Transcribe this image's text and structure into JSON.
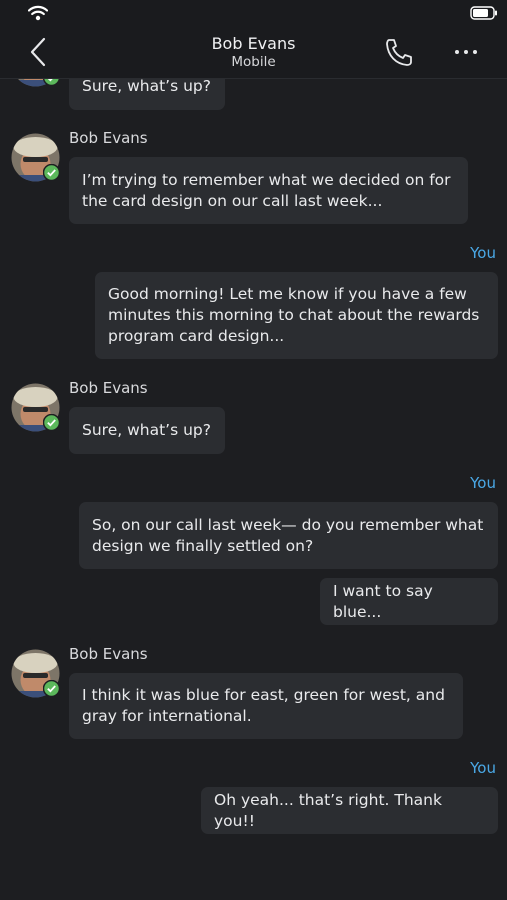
{
  "header": {
    "name": "Bob Evans",
    "subtitle": "Mobile"
  },
  "icons": {
    "back": "chevron-left-icon",
    "call": "phone-icon",
    "more": "more-icon",
    "wifi": "wifi-icon",
    "battery": "battery-icon",
    "verified": "check-badge-icon"
  },
  "colors": {
    "background": "#1d1e21",
    "bubble": "#2b2d31",
    "you_label": "#4aa8e6",
    "online_badge": "#5cb85c"
  },
  "messages": [
    {
      "sender": "",
      "text": "Sure, what’s up?"
    },
    {
      "sender": "Bob Evans",
      "text": "I’m trying to remember what we decided on for the card design on our call last week..."
    },
    {
      "sender": "You",
      "text": "Good morning! Let me know if you have a few minutes this morning to chat about the rewards program card design..."
    },
    {
      "sender": "Bob Evans",
      "text": "Sure, what’s up?"
    },
    {
      "sender": "You",
      "text": "So, on our call last week— do you remember what design we finally settled on?"
    },
    {
      "sender": "",
      "text": "I want to say blue..."
    },
    {
      "sender": "Bob Evans",
      "text": "I think it was blue for east, green for west, and gray for international."
    },
    {
      "sender": "You",
      "text": "Oh yeah... that’s right. Thank you!!"
    }
  ]
}
